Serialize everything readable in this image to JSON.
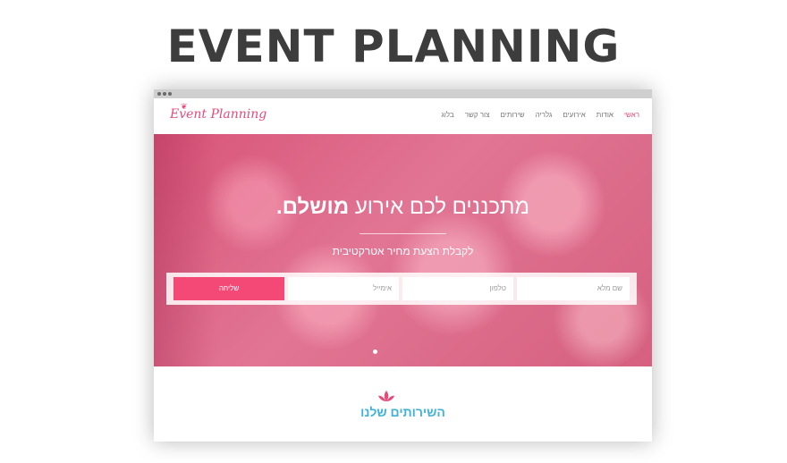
{
  "headline": "EVENT PLANNING",
  "site": {
    "logo_text": "Event Planning",
    "nav": [
      "ראשי",
      "אודות",
      "אירועים",
      "גלריה",
      "שירותים",
      "צור קשר",
      "בלוג"
    ],
    "hero_title_pre": "מתכננים לכם אירוע ",
    "hero_title_bold": "מושלם.",
    "hero_subtitle": "לקבלת הצעת מחיר אטרקטיבית",
    "search": {
      "button_label": "שליחה",
      "fields": [
        "שם מלא",
        "טלפון",
        "אימייל"
      ]
    },
    "services_title": "השירותים שלנו"
  },
  "colors": {
    "accent": "#f44977",
    "headline": "#3d3d3d",
    "services_title": "#3fb2d8"
  }
}
